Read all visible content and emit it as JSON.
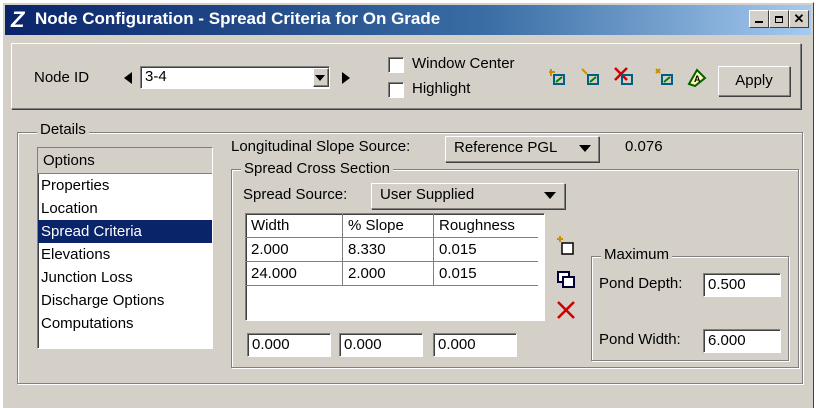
{
  "window": {
    "app_icon": "station-z-icon",
    "title": "Node Configuration - Spread Criteria for On Grade",
    "controls": [
      "minimize-icon",
      "maximize-icon",
      "close-icon"
    ]
  },
  "toolbar": {
    "node_id_label": "Node ID",
    "node_id_value": "3-4",
    "window_center_label": "Window Center",
    "highlight_label": "Highlight",
    "apply_label": "Apply"
  },
  "details": {
    "group_label": "Details",
    "options_header": "Options",
    "options": [
      "Properties",
      "Location",
      "Spread Criteria",
      "Elevations",
      "Junction Loss",
      "Discharge Options",
      "Computations"
    ],
    "selected_option": 2,
    "long_slope_label": "Longitudinal Slope Source:",
    "long_slope_value": "Reference PGL",
    "long_slope_number": "0.076",
    "spread_section_label": "Spread Cross Section",
    "spread_source_label": "Spread Source:",
    "spread_source_value": "User Supplied",
    "table": {
      "headers": [
        "Width",
        "% Slope",
        "Roughness"
      ],
      "rows": [
        [
          "2.000",
          "8.330",
          "0.015"
        ],
        [
          "24.000",
          "2.000",
          "0.015"
        ]
      ]
    },
    "entry": [
      "0.000",
      "0.000",
      "0.000"
    ],
    "maximum": {
      "label": "Maximum",
      "pond_depth_label": "Pond Depth:",
      "pond_depth_value": "0.500",
      "pond_width_label": "Pond Width:",
      "pond_width_value": "6.000"
    }
  },
  "colors": {
    "title_start": "#0a246a",
    "title_end": "#a6caf0",
    "selection": "#0a246a",
    "delete_x": "#cc0000"
  }
}
